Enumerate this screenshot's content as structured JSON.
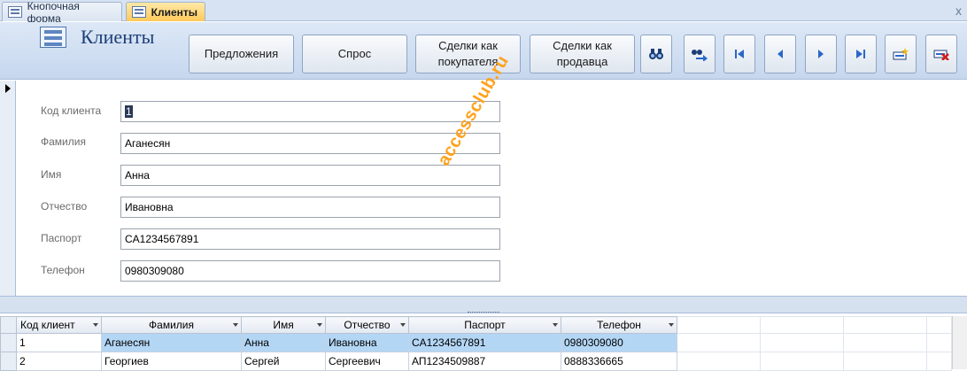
{
  "tabs": [
    {
      "label": "Кнопочная форма",
      "active": false
    },
    {
      "label": "Клиенты",
      "active": true
    }
  ],
  "close_glyph": "x",
  "form": {
    "title": "Клиенты",
    "buttons": [
      "Предложения",
      "Спрос",
      "Сделки как покупателя",
      "Сделки как продавца"
    ],
    "icon_buttons": [
      "find-icon",
      "find-next-icon",
      "first-record-icon",
      "previous-record-icon",
      "next-record-icon",
      "last-record-icon",
      "new-record-icon",
      "delete-record-icon"
    ]
  },
  "fields": [
    {
      "label": "Код клиента",
      "value": "1"
    },
    {
      "label": "Фамилия",
      "value": "Аганесян"
    },
    {
      "label": "Имя",
      "value": "Анна"
    },
    {
      "label": "Отчество",
      "value": "Ивановна"
    },
    {
      "label": "Паспорт",
      "value": "CA1234567891"
    },
    {
      "label": "Телефон",
      "value": "0980309080"
    }
  ],
  "watermark": "accessclub.ru",
  "datasheet": {
    "columns": [
      "Код клиент",
      "Фамилия",
      "Имя",
      "Отчество",
      "Паспорт",
      "Телефон"
    ],
    "rows": [
      [
        "1",
        "Аганесян",
        "Анна",
        "Ивановна",
        "CA1234567891",
        "0980309080"
      ],
      [
        "2",
        "Георгиев",
        "Сергей",
        "Сергеевич",
        "АП1234509887",
        "0888336665"
      ]
    ]
  },
  "colors": {
    "accent": "#1c3e78",
    "active_tab": "#ffc95a",
    "selection": "#b4d6f5",
    "watermark": "#ffa21d"
  }
}
